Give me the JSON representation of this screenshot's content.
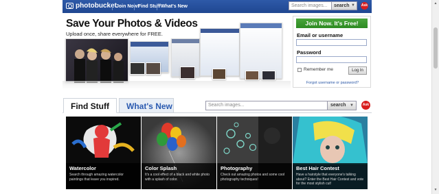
{
  "header": {
    "logo_text": "photobucket",
    "nav": [
      "Join Now!",
      "Find Stuff",
      "What's New"
    ],
    "search_placeholder": "Search images...",
    "search_button": "search",
    "ask_label": "Ask"
  },
  "hero": {
    "title": "Save Your Photos & Videos",
    "subtitle": "Upload once, share everywhere for FREE."
  },
  "login": {
    "join_button": "Join Now. It's Free!",
    "email_label": "Email or username",
    "password_label": "Password",
    "remember_label": "Remember me",
    "login_button": "Log In",
    "forgot_link": "Forgot username or password?"
  },
  "tabs": {
    "find_stuff": "Find Stuff",
    "whats_new": "What's New",
    "search_placeholder": "Search images...",
    "search_button": "search"
  },
  "cards": [
    {
      "title": "Watercolor",
      "desc": "Search through amazing watercolor paintings that leave you inspired."
    },
    {
      "title": "Color Splash",
      "desc": "It's a cool effect of a black and white photo with a splash of color."
    },
    {
      "title": "Photography",
      "desc": "Check out amazing photos and some cool photography techniques!"
    },
    {
      "title": "Best Hair Contest",
      "desc": "Have a hairstyle that everyone's talking about? Enter the Best Hair Contest and vote for the most stylish cut!"
    }
  ],
  "colors": {
    "nav_blue": "#1f4791",
    "join_green": "#2d8a22",
    "link_blue": "#2a57a6"
  }
}
